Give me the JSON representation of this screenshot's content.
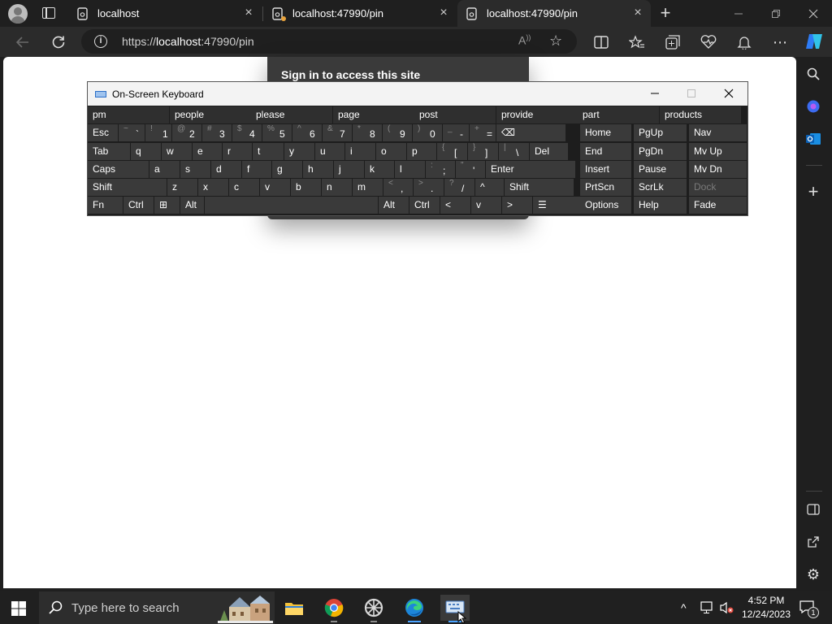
{
  "browser": {
    "tabs": [
      {
        "title": "localhost",
        "active": false
      },
      {
        "title": "localhost:47990/pin",
        "active": false
      },
      {
        "title": "localhost:47990/pin",
        "active": true
      }
    ],
    "address": {
      "prefix": "https://",
      "host": "localhost",
      "rest": ":47990/pin"
    },
    "accent": "#4aa3ff"
  },
  "dialog": {
    "title": "Sign in to access this site"
  },
  "osk": {
    "title": "On-Screen Keyboard",
    "predictions": [
      "pm",
      "people",
      "please",
      "page",
      "post",
      "provide",
      "part",
      "products"
    ],
    "row1": [
      {
        "label": "Esc"
      },
      {
        "shift": "~",
        "main": "`"
      },
      {
        "shift": "!",
        "main": "1"
      },
      {
        "shift": "@",
        "main": "2"
      },
      {
        "shift": "#",
        "main": "3"
      },
      {
        "shift": "$",
        "main": "4"
      },
      {
        "shift": "%",
        "main": "5"
      },
      {
        "shift": "^",
        "main": "6"
      },
      {
        "shift": "&",
        "main": "7"
      },
      {
        "shift": "*",
        "main": "8"
      },
      {
        "shift": "(",
        "main": "9"
      },
      {
        "shift": ")",
        "main": "0"
      },
      {
        "shift": "_",
        "main": "-"
      },
      {
        "shift": "+",
        "main": "="
      },
      {
        "label": "⌫"
      }
    ],
    "row2": [
      {
        "label": "Tab"
      },
      {
        "label": "q"
      },
      {
        "label": "w"
      },
      {
        "label": "e"
      },
      {
        "label": "r"
      },
      {
        "label": "t"
      },
      {
        "label": "y"
      },
      {
        "label": "u"
      },
      {
        "label": "i"
      },
      {
        "label": "o"
      },
      {
        "label": "p"
      },
      {
        "shift": "{",
        "main": "["
      },
      {
        "shift": "}",
        "main": "]"
      },
      {
        "shift": "|",
        "main": "\\"
      },
      {
        "label": "Del"
      }
    ],
    "row3": [
      {
        "label": "Caps"
      },
      {
        "label": "a"
      },
      {
        "label": "s"
      },
      {
        "label": "d"
      },
      {
        "label": "f"
      },
      {
        "label": "g"
      },
      {
        "label": "h"
      },
      {
        "label": "j"
      },
      {
        "label": "k"
      },
      {
        "label": "l"
      },
      {
        "shift": ":",
        "main": ";"
      },
      {
        "shift": "\"",
        "main": "'"
      },
      {
        "label": "Enter"
      }
    ],
    "row4": [
      {
        "label": "Shift"
      },
      {
        "label": "z"
      },
      {
        "label": "x"
      },
      {
        "label": "c"
      },
      {
        "label": "v"
      },
      {
        "label": "b"
      },
      {
        "label": "n"
      },
      {
        "label": "m"
      },
      {
        "shift": "<",
        "main": ","
      },
      {
        "shift": ">",
        "main": "."
      },
      {
        "shift": "?",
        "main": "/"
      },
      {
        "label": "^"
      },
      {
        "label": "Shift"
      }
    ],
    "row5": [
      {
        "label": "Fn"
      },
      {
        "label": "Ctrl"
      },
      {
        "label": "⊞"
      },
      {
        "label": "Alt"
      },
      {
        "label": ""
      },
      {
        "label": "Alt"
      },
      {
        "label": "Ctrl"
      },
      {
        "label": "<"
      },
      {
        "label": "v"
      },
      {
        "label": ">"
      },
      {
        "label": "☰"
      }
    ],
    "nav": [
      [
        "Home",
        "PgUp",
        "Nav"
      ],
      [
        "End",
        "PgDn",
        "Mv Up"
      ],
      [
        "Insert",
        "Pause",
        "Mv Dn"
      ],
      [
        "PrtScn",
        "ScrLk",
        "Dock"
      ],
      [
        "Options",
        "Help",
        "Fade"
      ]
    ]
  },
  "taskbar": {
    "search_placeholder": "Type here to search",
    "time": "4:52 PM",
    "date": "12/24/2023",
    "notification_count": "1"
  }
}
